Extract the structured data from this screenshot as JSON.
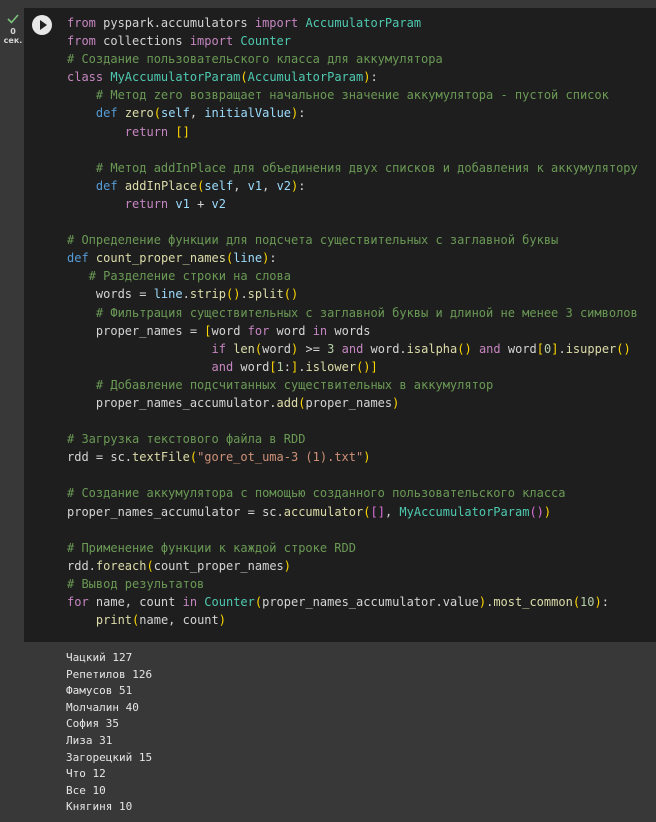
{
  "cell": {
    "exec_time": "0\nсек.",
    "run_button_label": "Run cell"
  },
  "code_lines": [
    "from pyspark.accumulators import AccumulatorParam",
    "from collections import Counter",
    "# Создание пользовательского класса для аккумулятора",
    "class MyAccumulatorParam(AccumulatorParam):",
    "    # Метод zero возвращает начальное значение аккумулятора - пустой список",
    "    def zero(self, initialValue):",
    "        return []",
    "",
    "    # Метод addInPlace для объединения двух списков и добавления к аккумулятору",
    "    def addInPlace(self, v1, v2):",
    "        return v1 + v2",
    "",
    "# Определение функции для подсчета существительных с заглавной буквы",
    "def count_proper_names(line):",
    "   # Разделение строки на слова",
    "    words = line.strip().split()",
    "    # Фильтрация существительных с заглавной буквы и длиной не менее 3 символов",
    "    proper_names = [word for word in words",
    "                    if len(word) >= 3 and word.isalpha() and word[0].isupper()",
    "                    and word[1:].islower()]",
    "    # Добавление подсчитанных существительных в аккумулятор",
    "    proper_names_accumulator.add(proper_names)",
    "",
    "# Загрузка текстового файла в RDD",
    "rdd = sc.textFile(\"gore_ot_uma-3 (1).txt\")",
    "",
    "# Создание аккумулятора с помощью созданного пользовательского класса",
    "proper_names_accumulator = sc.accumulator([], MyAccumulatorParam())",
    "",
    "# Применение функции к каждой строке RDD",
    "rdd.foreach(count_proper_names)",
    "# Вывод результатов",
    "for name, count in Counter(proper_names_accumulator.value).most_common(10):",
    "    print(name, count)"
  ],
  "output_lines": [
    "Чацкий 127",
    "Репетилов 126",
    "Фамусов 51",
    "Молчалин 40",
    "София 35",
    "Лиза 31",
    "Загорецкий 15",
    "Что 12",
    "Все 10",
    "Княгиня 10"
  ],
  "colors": {
    "background": "#383838",
    "editor_background": "#1e1e1e",
    "check": "#7cc47f",
    "keyword": "#c586c0",
    "keyword_def": "#569cd6",
    "class_name": "#4ec9b0",
    "function": "#dcdcaa",
    "parameter": "#9cdcfe",
    "comment": "#6a9955",
    "string": "#ce9178",
    "number": "#b5cea8"
  },
  "icons": {
    "status": "check-icon",
    "run": "play-icon"
  }
}
